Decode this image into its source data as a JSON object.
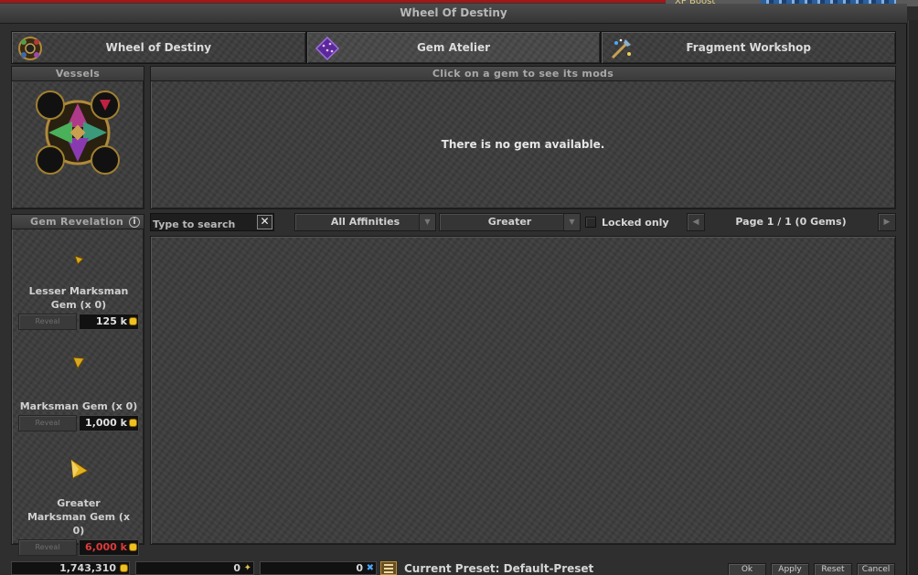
{
  "window": {
    "title": "Wheel Of Destiny"
  },
  "top_strip": {
    "xp_boost": "XP Boost"
  },
  "tabs": [
    {
      "label": "Wheel of Destiny",
      "icon": "wheel-icon"
    },
    {
      "label": "Gem Atelier",
      "icon": "gem-atelier-icon",
      "active": true
    },
    {
      "label": "Fragment Workshop",
      "icon": "fragment-workshop-icon"
    }
  ],
  "vessels": {
    "header": "Vessels"
  },
  "gem_mods": {
    "header": "Click on a gem to see its mods",
    "empty_message": "There is no gem available."
  },
  "revelation": {
    "header": "Gem Revelation",
    "gems": [
      {
        "name": "Lesser Marksman Gem (x 0)",
        "button": "Reveal",
        "price": "125 k",
        "price_color": "#e2e2e2"
      },
      {
        "name": "Marksman Gem (x 0)",
        "button": "Reveal",
        "price": "1,000 k",
        "price_color": "#e2e2e2"
      },
      {
        "name": "Greater Marksman Gem (x 0)",
        "button": "Reveal",
        "price": "6,000 k",
        "price_color": "#e03a3a"
      }
    ]
  },
  "toolbar": {
    "search_placeholder": "Type to search",
    "affinity_value": "All Affinities",
    "grade_value": "Greater",
    "locked_only_label": "Locked only",
    "locked_only_checked": false,
    "page_label": "Page 1 / 1 (0 Gems)"
  },
  "footer": {
    "gold": "1,743,310",
    "lesser_fragments": "0",
    "greater_fragments": "0",
    "preset_label": "Current Preset: Default-Preset",
    "buttons": {
      "ok": "Ok",
      "apply": "Apply",
      "reset": "Reset",
      "cancel": "Cancel"
    }
  }
}
